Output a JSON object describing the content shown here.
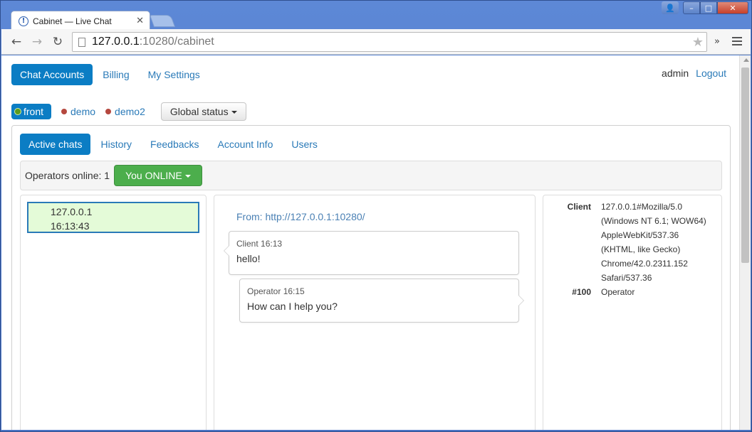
{
  "browser": {
    "tab_title": "Cabinet — Live Chat",
    "tab_favicon": "info-icon",
    "url_host": "127.0.0.1",
    "url_rest": ":10280/cabinet"
  },
  "topnav": {
    "items": [
      "Chat Accounts",
      "Billing",
      "My Settings"
    ],
    "active_index": 0
  },
  "user": {
    "name": "admin",
    "logout": "Logout"
  },
  "accounts": {
    "items": [
      {
        "label": "front",
        "status": "online"
      },
      {
        "label": "demo",
        "status": "offline"
      },
      {
        "label": "demo2",
        "status": "offline"
      }
    ],
    "global_status": "Global status"
  },
  "subtabs": {
    "items": [
      "Active chats",
      "History",
      "Feedbacks",
      "Account Info",
      "Users"
    ],
    "active_index": 0
  },
  "operators": {
    "label": "Operators online: 1",
    "my_status": "You ONLINE"
  },
  "chat_list": [
    {
      "ip": "127.0.0.1",
      "time": "16:13:43"
    }
  ],
  "conversation": {
    "from": "From: http://127.0.0.1:10280/",
    "messages": [
      {
        "meta": "Client 16:13",
        "text": "hello!"
      },
      {
        "meta": "Operator 16:15",
        "text": "How can I help you?"
      }
    ]
  },
  "client_info": [
    {
      "key": "Client",
      "value": "127.0.0.1#Mozilla/5.0 (Windows NT 6.1; WOW64) AppleWebKit/537.36 (KHTML, like Gecko) Chrome/42.0.2311.152 Safari/537.36"
    },
    {
      "key": "#100",
      "value": "Operator"
    }
  ],
  "colors": {
    "accent": "#0b7dc4",
    "online_green": "#4cae4c",
    "chat_item_bg": "#e4fbd8",
    "offline_dot": "#b5483f"
  }
}
